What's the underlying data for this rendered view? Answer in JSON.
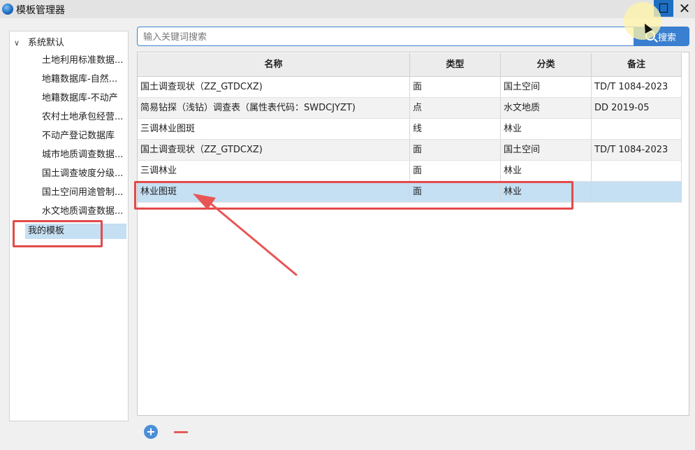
{
  "window": {
    "title": "模板管理器",
    "close_symbol": "✕"
  },
  "sidebar": {
    "root_label": "系统默认",
    "items": [
      "土地利用标准数据...",
      "地籍数据库-自然...",
      "地籍数据库-不动产",
      "农村土地承包经营...",
      "不动产登记数据库",
      "城市地质调查数据...",
      "国土调查坡度分级...",
      "国土空间用途管制...",
      "水文地质调查数据..."
    ],
    "my_templates": "我的模板"
  },
  "search": {
    "placeholder": "输入关键词搜索",
    "value": "",
    "button_label": "搜索"
  },
  "table": {
    "columns": [
      "名称",
      "类型",
      "分类",
      "备注"
    ],
    "rows": [
      [
        "国土调查现状（ZZ_GTDCXZ)",
        "面",
        "国土空间",
        "TD/T 1084-2023"
      ],
      [
        "简易钻探（浅钻）调查表（属性表代码：SWDCJYZT)",
        "点",
        "水文地质",
        "DD 2019-05"
      ],
      [
        "三调林业图斑",
        "线",
        "林业",
        ""
      ],
      [
        "国土调查现状（ZZ_GTDCXZ)",
        "面",
        "国土空间",
        "TD/T 1084-2023"
      ],
      [
        "三调林业",
        "面",
        "林业",
        ""
      ],
      [
        "林业图斑",
        "面",
        "林业",
        ""
      ]
    ],
    "selected_row": 5
  },
  "colors": {
    "accent": "#3a7fd0",
    "selection": "#c5dff3",
    "annotation": "#e34a4a"
  }
}
